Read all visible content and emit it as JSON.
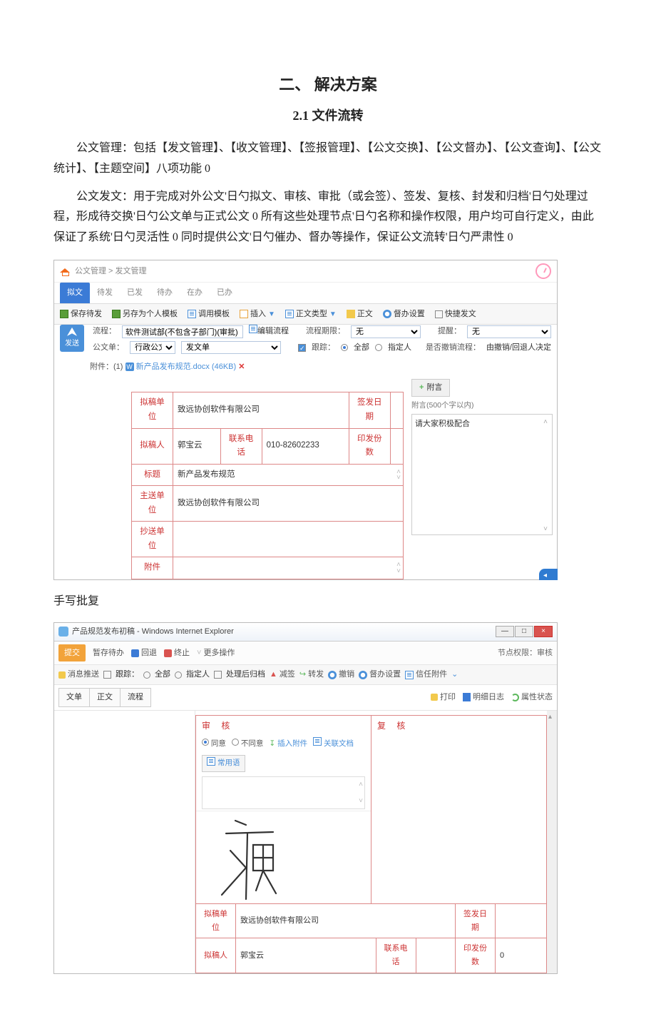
{
  "doc": {
    "h1": "二、 解决方案",
    "h2": "2.1 文件流转",
    "p1": "公文管理：包括【发文管理】、【收文管理】、【签报管理】、【公文交换】、【公文督办】、【公文查询】、【公文统计】、【主题空间】八项功能 0",
    "p2": "公文发文：用于完成对外公文'日勺拟文、审核、审批（或会签）、签发、复核、封发和归档'日勺处理过程，形成待交换'日勺公文单与正式公文 0 所有这些处理节点'日勺名称和操作权限，用户均可自行定义，由此保证了系统'日勺灵活性 0 同时提供公文'日勺催办、督办等操作，保证公文流转'日勺严肃性 0",
    "subtitle": "手写批复"
  },
  "ss1": {
    "breadcrumb": "公文管理 > 发文管理",
    "tabs": [
      "拟文",
      "待发",
      "已发",
      "待办",
      "在办",
      "已办"
    ],
    "toolbar": {
      "save_draft": "保存待发",
      "save_tpl": "另存为个人模板",
      "use_tpl": "调用模板",
      "insert": "插入",
      "body_type": "正文类型",
      "body": "正文",
      "reminder_setting": "督办设置",
      "quick_send": "快捷发文"
    },
    "send_btn": "发送",
    "fields": {
      "flow_lbl": "流程：",
      "flow_val": "软件测试部(不包含子部门)(审批)",
      "edit_flow": "编辑流程",
      "flow_period_lbl": "流程期限：",
      "flow_period_val": "无",
      "remind_lbl": "提醒：",
      "remind_val": "无",
      "unit_lbl": "公文单：",
      "unit_val": "行政公文",
      "doc_type": "发文单",
      "track_lbl": "跟踪：",
      "track_all": "全部",
      "track_spec": "指定人",
      "cancel_flow_lbl": "是否撤销流程：",
      "cancel_flow_val": "由撤销/回退人决定"
    },
    "attachment": {
      "lbl": "附件：(1)",
      "name": "新产品发布规范.docx (46KB)"
    },
    "table": {
      "draft_unit_lbl": "拟稿单位",
      "draft_unit": "致远协创软件有限公司",
      "sign_date_lbl": "签发日期",
      "sign_date": "",
      "drafter_lbl": "拟稿人",
      "drafter": "郭宝云",
      "phone_lbl": "联系电话",
      "phone": "010-82602233",
      "copies_lbl": "印发份数",
      "copies": "",
      "title_lbl": "标题",
      "title": "新产品发布规范",
      "main_to_lbl": "主送单位",
      "main_to": "致远协创软件有限公司",
      "cc_lbl": "抄送单位",
      "cc": "",
      "att_lbl": "附件",
      "att": ""
    },
    "side": {
      "fuyan_btn": "附言",
      "hint": "附言(500个字以内)",
      "placeholder": "请大家积极配合"
    }
  },
  "ss2": {
    "win_title": "产品规范发布初稿 - Windows Internet Explorer",
    "win_btns": {
      "min": "—",
      "max": "□",
      "close": "×"
    },
    "bar2": {
      "submit": "提交",
      "save_wait": "暂存待办",
      "return": "回退",
      "stop": "终止",
      "more": "更多操作",
      "node_auth_lbl": "节点权限：",
      "node_auth_val": "审核"
    },
    "bar3": {
      "msg_push": "消息推送",
      "track": "跟踪：",
      "all": "全部",
      "spec": "指定人",
      "archive": "处理后归档",
      "reduce_sign": "减签",
      "transfer": "转发",
      "cancel": "撤销",
      "reminder": "督办设置",
      "trust_att": "信任附件"
    },
    "bar4": {
      "tabs": [
        "文单",
        "正文",
        "流程"
      ],
      "print": "打印",
      "log": "明细日志",
      "attr": "属性状态"
    },
    "audit": {
      "title": "审 核",
      "agree": "同意",
      "disagree": "不同意",
      "ins_att": "插入附件",
      "rel_doc": "关联文档",
      "common": "常用语"
    },
    "recheck": {
      "title": "复 核"
    },
    "table": {
      "draft_unit_lbl": "拟稿单位",
      "draft_unit": "致远协创软件有限公司",
      "sign_date_lbl": "签发日期",
      "sign_date": "",
      "drafter_lbl": "拟稿人",
      "drafter": "郭宝云",
      "phone_lbl": "联系电话",
      "phone": "",
      "copies_lbl": "印发份数",
      "copies": "0"
    }
  }
}
